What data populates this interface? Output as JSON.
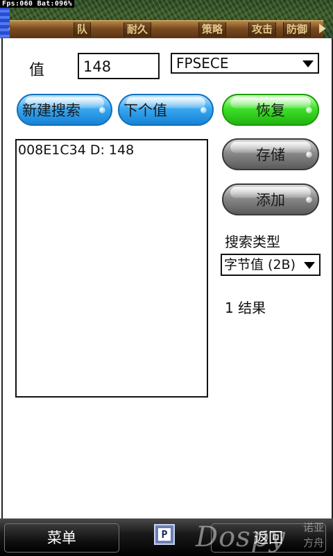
{
  "status_bar": {
    "text": "Fps:060  Bat:096%"
  },
  "game_menu": {
    "tabs": [
      "队",
      "耐久",
      "策略",
      "攻击",
      "防御"
    ]
  },
  "search_form": {
    "value_label": "值",
    "value_input": "148",
    "process_select": "FPSECE"
  },
  "buttons": {
    "new_search": "新建搜索",
    "next_value": "下个值",
    "restore": "恢复",
    "save": "存储",
    "add": "添加"
  },
  "results": {
    "rows": [
      "008E1C34 D: 148"
    ]
  },
  "search_type": {
    "label": "搜索类型",
    "selected": "字节值 (2B)"
  },
  "result_count": "1 结果",
  "softkeys": {
    "left": "菜单",
    "right": "返回"
  },
  "watermark": {
    "text": "Dospy",
    "cn": "诺亚方舟"
  },
  "colors": {
    "blue_pill": "#3ba8f0",
    "green_pill": "#3fe02a",
    "gray_pill": "#8a8a8a"
  }
}
